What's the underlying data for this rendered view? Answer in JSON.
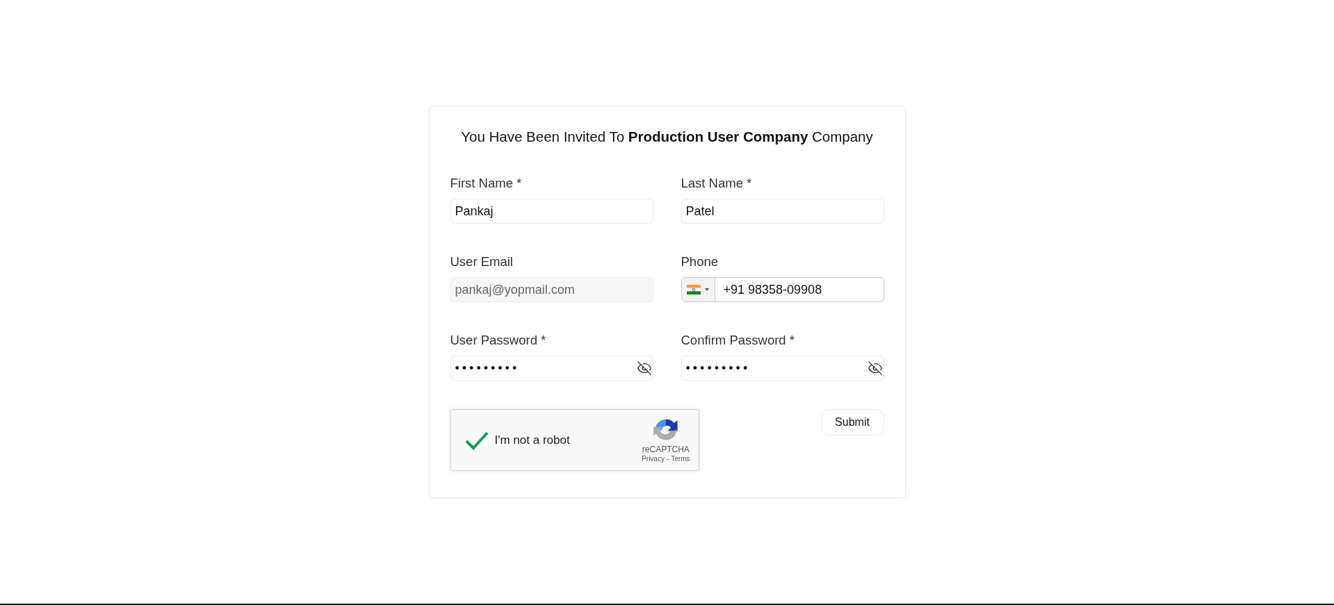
{
  "title": "You Have Been Invited To **Production User Company** Company",
  "fields": [
    {
      "kind": "text",
      "label": "First Name *",
      "value": "Pankaj",
      "disabled": false
    },
    {
      "kind": "text",
      "label": "Last Name *",
      "value": "Patel",
      "disabled": false
    },
    {
      "kind": "text",
      "label": "User Email",
      "value": "pankaj@yopmail.com",
      "disabled": true
    },
    {
      "kind": "phone",
      "label": "Phone",
      "value": "+91 98358-09908",
      "disabled": false
    },
    {
      "kind": "password",
      "label": "User Password *",
      "value": "•••••••••",
      "disabled": false
    },
    {
      "kind": "password",
      "label": "Confirm Password *",
      "value": "•••••••••",
      "disabled": false
    }
  ],
  "captcha": {
    "checked": true,
    "label": "I'm not a robot",
    "brand": "reCAPTCHA",
    "links": [
      "Privacy",
      "Terms"
    ],
    "separator": "-"
  },
  "submit": {
    "label": "Submit"
  }
}
